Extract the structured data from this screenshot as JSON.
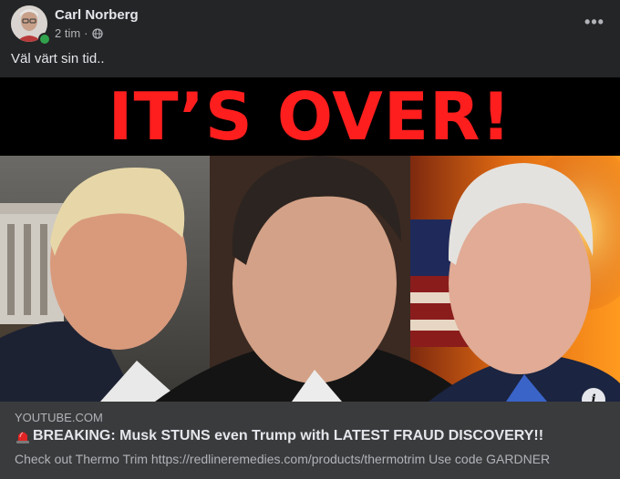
{
  "post": {
    "author": "Carl Norberg",
    "time": "2 tim",
    "separator": "·",
    "privacy_icon": "globe-icon",
    "more_icon": "more-options-icon",
    "more_label": "•••",
    "caption": "Väl värt sin tid.."
  },
  "thumbnail": {
    "headline": "IT’S OVER!",
    "info_label": "i"
  },
  "link": {
    "domain": "YOUTUBE.COM",
    "title_icon": "siren-icon",
    "title": "BREAKING: Musk STUNS even Trump with LATEST FRAUD DISCOVERY!!",
    "description": "Check out Thermo Trim https://redlineremedies.com/products/thermotrim Use code GARDNER"
  },
  "colors": {
    "background": "#242526",
    "card": "#3a3b3c",
    "headline_red": "#ff1e1e",
    "online_green": "#31a24c"
  }
}
